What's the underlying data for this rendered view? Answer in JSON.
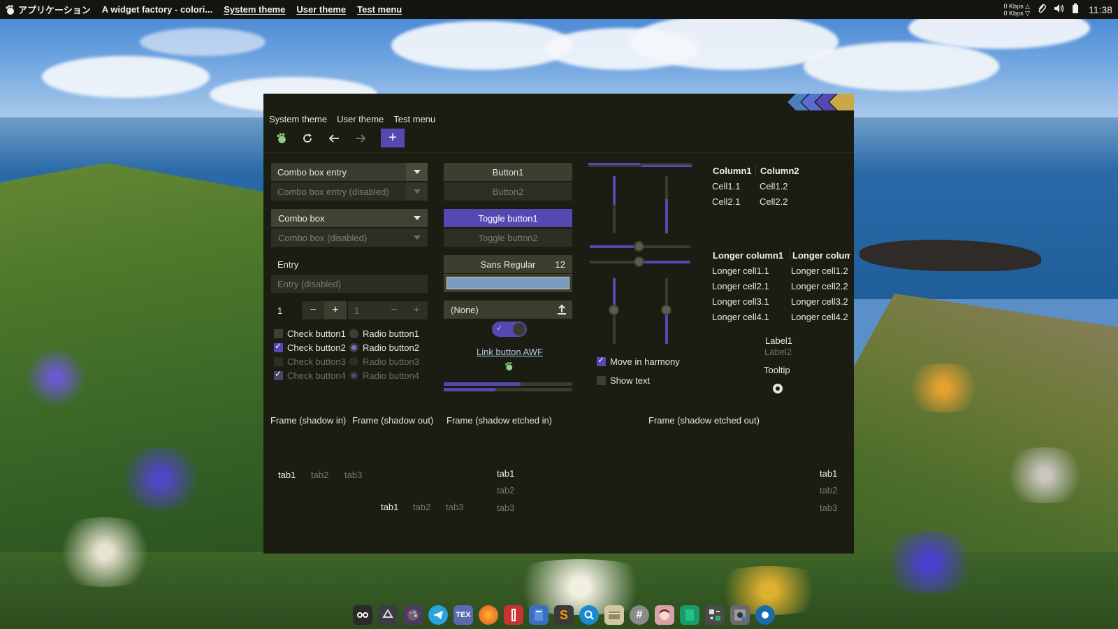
{
  "top_panel": {
    "app_menu": "アプリケーション",
    "window_title": "A widget factory - colori...",
    "menus": [
      "System theme",
      "User theme",
      "Test menu"
    ],
    "net_up": "0 Kbps △",
    "net_down": "0 Kbps ▽",
    "clock": "11:38"
  },
  "window": {
    "menubar": [
      "System theme",
      "User theme",
      "Test menu"
    ],
    "toolbar": {
      "icons": [
        "gnome-foot-icon",
        "refresh-icon",
        "back-icon",
        "forward-icon",
        "add-icon"
      ],
      "add_label": "+"
    },
    "col1": {
      "combo_entry": "Combo box entry",
      "combo_entry_disabled": "Combo box entry (disabled)",
      "combo_box": "Combo box",
      "combo_box_disabled": "Combo box (disabled)",
      "entry_label": "Entry",
      "entry_disabled_placeholder": "Entry (disabled)",
      "spin1_value": "1",
      "spin2_value": "1",
      "checks": [
        {
          "label": "Check button1",
          "checked": false,
          "disabled": false
        },
        {
          "label": "Check button2",
          "checked": true,
          "disabled": false
        },
        {
          "label": "Check button3",
          "checked": false,
          "disabled": true
        },
        {
          "label": "Check button4",
          "checked": true,
          "disabled": true
        }
      ],
      "radios": [
        {
          "label": "Radio button1",
          "checked": false,
          "disabled": false
        },
        {
          "label": "Radio button2",
          "checked": true,
          "disabled": false
        },
        {
          "label": "Radio button3",
          "checked": false,
          "disabled": true
        },
        {
          "label": "Radio button4",
          "checked": true,
          "disabled": true
        }
      ]
    },
    "col2": {
      "button1": "Button1",
      "button2": "Button2",
      "toggle1": "Toggle button1",
      "toggle2": "Toggle button2",
      "font_name": "Sans Regular",
      "font_size": "12",
      "color_value": "#7a9cc0",
      "file_chooser": "(None)",
      "switch_on": true,
      "link_button": "Link button AWF",
      "progress1": 0.6,
      "progress2": 0.4
    },
    "col3": {
      "move_in_harmony": "Move in harmony",
      "move_in_harmony_checked": true,
      "show_text": "Show text",
      "show_text_checked": false,
      "hscale1": 0.5,
      "hscale2": 0.5,
      "vscale1": 0.5,
      "vscale2": 0.5,
      "vprog1": 0.5,
      "vprog2": 0.6
    },
    "tree1": {
      "headers": [
        "Column1",
        "Column2"
      ],
      "rows": [
        [
          "Cell1.1",
          "Cell1.2"
        ],
        [
          "Cell2.1",
          "Cell2.2"
        ]
      ]
    },
    "tree2": {
      "headers": [
        "Longer column1",
        "Longer colum"
      ],
      "rows": [
        [
          "Longer cell1.1",
          "Longer cell1.2"
        ],
        [
          "Longer cell2.1",
          "Longer cell2.2"
        ],
        [
          "Longer cell3.1",
          "Longer cell3.2"
        ],
        [
          "Longer cell4.1",
          "Longer cell4.2"
        ]
      ]
    },
    "labels": {
      "label1": "Label1",
      "label2": "Label2",
      "tooltip": "Tooltip"
    },
    "frames": [
      "Frame (shadow in)",
      "Frame (shadow out)",
      "Frame (shadow etched in)",
      "Frame (shadow etched out)"
    ],
    "tabs": [
      "tab1",
      "tab2",
      "tab3"
    ]
  },
  "colors": {
    "accent": "#5548b3",
    "window_bg": "#1c1d12",
    "widget_bg": "#3d3e30",
    "panel_bg": "#141410"
  },
  "dock": {
    "icons": [
      "face-icon",
      "recycle-icon",
      "palette-icon",
      "telegram-icon",
      "tex-icon",
      "firefox-icon",
      "archive-icon",
      "book-icon",
      "sublime-icon",
      "search-icon",
      "files-icon",
      "hash-icon",
      "anime-icon",
      "green-book-icon",
      "calculator-icon",
      "disk-icon",
      "record-icon"
    ],
    "tex_label": "TEX"
  }
}
